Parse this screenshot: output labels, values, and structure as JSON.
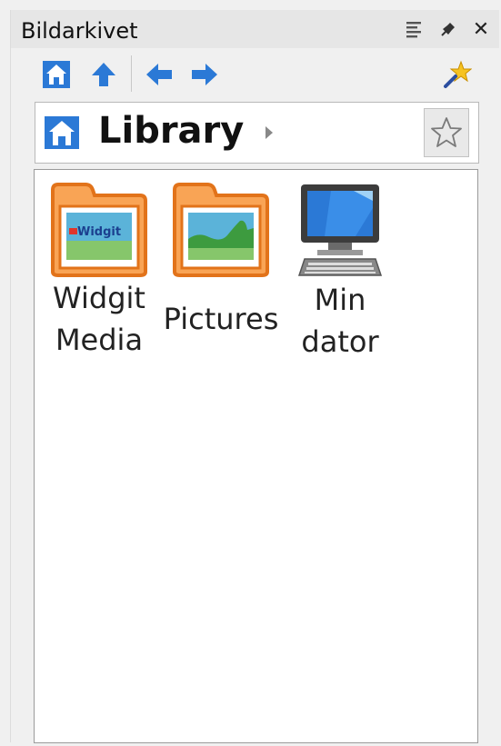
{
  "window": {
    "title": "Bildarkivet",
    "controls": [
      "menu-icon",
      "pin-icon",
      "close-icon"
    ],
    "close_label": "✕"
  },
  "toolbar": {
    "buttons": [
      "home-icon",
      "up-arrow-icon",
      "back-arrow-icon",
      "forward-arrow-icon",
      "favorites-star-icon"
    ]
  },
  "addressbar": {
    "location": "Library",
    "arrow": "▸",
    "favorite_star": "☆"
  },
  "items": [
    {
      "label": "Widgit\nMedia",
      "icon": "folder-widgit-icon",
      "folder_badge": "Widgit"
    },
    {
      "label": "Pictures",
      "icon": "folder-pictures-icon"
    },
    {
      "label": "Min\ndator",
      "icon": "computer-icon"
    }
  ],
  "colors": {
    "accent_blue": "#2b79d6",
    "folder_orange": "#f08a2b",
    "folder_fill": "#f9a455"
  }
}
